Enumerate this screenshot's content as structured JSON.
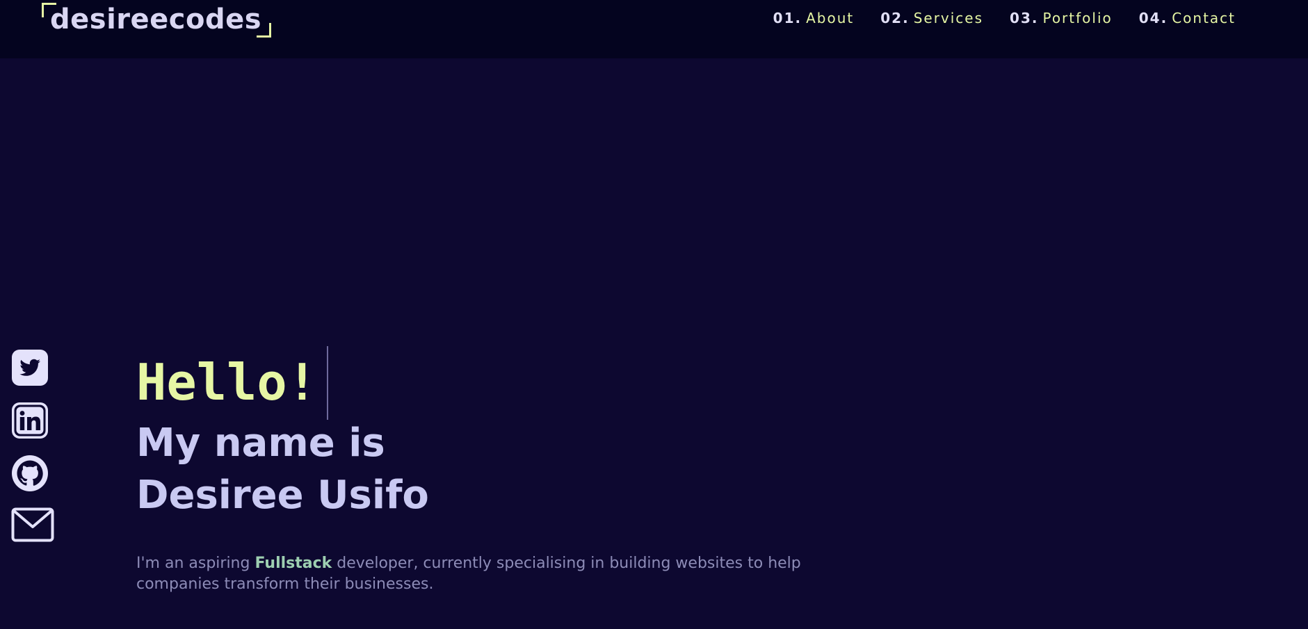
{
  "logo": {
    "text": "desireecodes"
  },
  "nav": {
    "items": [
      {
        "num": "01.",
        "label": "About"
      },
      {
        "num": "02.",
        "label": "Services"
      },
      {
        "num": "03.",
        "label": "Portfolio"
      },
      {
        "num": "04.",
        "label": "Contact"
      }
    ]
  },
  "socials": [
    {
      "icon": "twitter-icon"
    },
    {
      "icon": "linkedin-icon"
    },
    {
      "icon": "github-icon"
    },
    {
      "icon": "mail-icon"
    }
  ],
  "hero": {
    "greeting": "Hello!",
    "name_line1": "My name is",
    "name_line2": "Desiree Usifo",
    "intro_before": "I'm an aspiring ",
    "intro_highlight": "Fullstack",
    "intro_after": " developer, currently specialising in building websites to help companies transform their businesses."
  },
  "colors": {
    "background": "#0d0830",
    "navbar": "#04041f",
    "accent": "#e6f6a4",
    "heading": "#c9c9f2",
    "muted": "#8d8cb7",
    "highlight": "#9ecfb1",
    "icon": "#e4e2fb"
  }
}
